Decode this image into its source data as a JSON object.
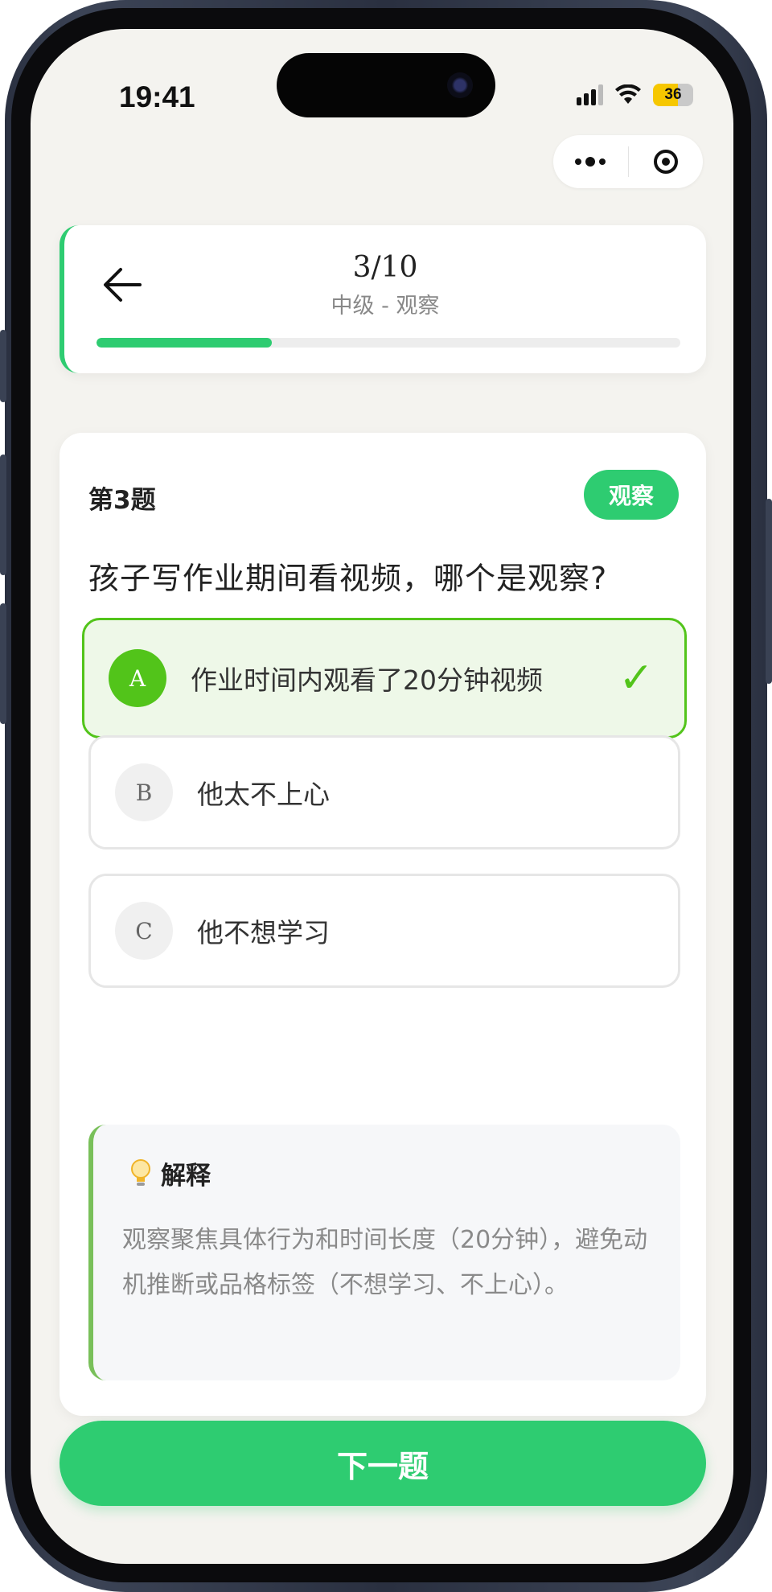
{
  "status_bar": {
    "time": "19:41",
    "battery": "36"
  },
  "header": {
    "progress_count": "3/10",
    "progress_fraction": 0.3,
    "level_label": "中级 - 观察"
  },
  "question": {
    "number_label": "第3题",
    "tag": "观察",
    "text": "孩子写作业期间看视频，哪个是观察?",
    "options": [
      {
        "letter": "A",
        "text": "作业时间内观看了20分钟视频",
        "selected": true,
        "mark": "✓"
      },
      {
        "letter": "B",
        "text": "他太不上心",
        "selected": false
      },
      {
        "letter": "C",
        "text": "他不想学习",
        "selected": false
      }
    ]
  },
  "explanation": {
    "icon": "lightbulb-icon",
    "title": "解释",
    "body": "观察聚焦具体行为和时间长度（20分钟），避免动机推断或品格标签（不想学习、不上心）。"
  },
  "footer": {
    "next_label": "下一题"
  },
  "colors": {
    "accent": "#2ecc71",
    "selected": "#52c41a",
    "selected_bg": "#eef8e8",
    "page_bg": "#f4f3ef"
  }
}
